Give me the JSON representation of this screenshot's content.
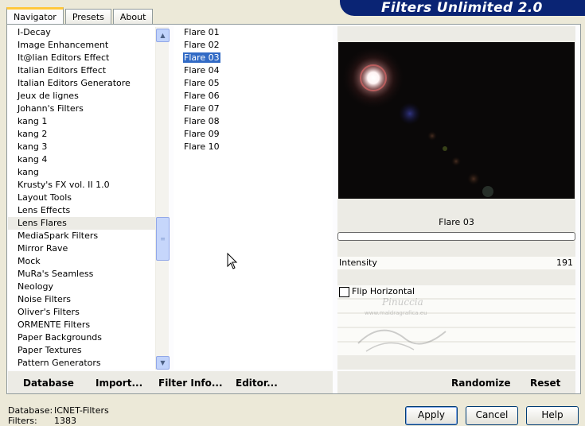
{
  "tabs": [
    "Navigator",
    "Presets",
    "About"
  ],
  "banner": "Filters Unlimited 2.0",
  "categories": [
    "I-Decay",
    "Image Enhancement",
    "It@lian Editors Effect",
    "Italian Editors Effect",
    "Italian Editors Generatore",
    "Jeux de lignes",
    "Johann's Filters",
    "kang 1",
    "kang 2",
    "kang 3",
    "kang 4",
    "kang",
    "Krusty's FX vol. II 1.0",
    "Layout Tools",
    "Lens Effects",
    "Lens Flares",
    "MediaSpark Filters",
    "Mirror Rave",
    "Mock",
    "MuRa's Seamless",
    "Neology",
    "Noise Filters",
    "Oliver's Filters",
    "ORMENTE Filters",
    "Paper Backgrounds",
    "Paper Textures",
    "Pattern Generators"
  ],
  "selected_category": "Lens Flares",
  "filters": [
    "Flare 01",
    "Flare 02",
    "Flare 03",
    "Flare 04",
    "Flare 05",
    "Flare 06",
    "Flare 07",
    "Flare 08",
    "Flare 09",
    "Flare 10"
  ],
  "selected_filter": "Flare 03",
  "bottom_buttons": {
    "database": "Database",
    "import": "Import...",
    "filter_info": "Filter Info...",
    "editor": "Editor..."
  },
  "preview": {
    "title": "Flare 03",
    "intensity_label": "Intensity",
    "intensity_value": "191",
    "flip_label": "Flip Horizontal",
    "flip_checked": false
  },
  "right_buttons": {
    "randomize": "Randomize",
    "reset": "Reset"
  },
  "info": {
    "db_label": "Database:",
    "db_value": "ICNET-Filters",
    "filters_label": "Filters:",
    "filters_value": "1383"
  },
  "dialog_buttons": {
    "apply": "Apply",
    "cancel": "Cancel",
    "help": "Help"
  },
  "watermark": {
    "line1": "Pinuccia",
    "line2": "www.maldragrafica.eu"
  },
  "icons": {
    "scroll_up": "scroll-up-arrow-icon",
    "scroll_down": "scroll-down-arrow-icon",
    "cursor": "mouse-pointer-icon"
  }
}
